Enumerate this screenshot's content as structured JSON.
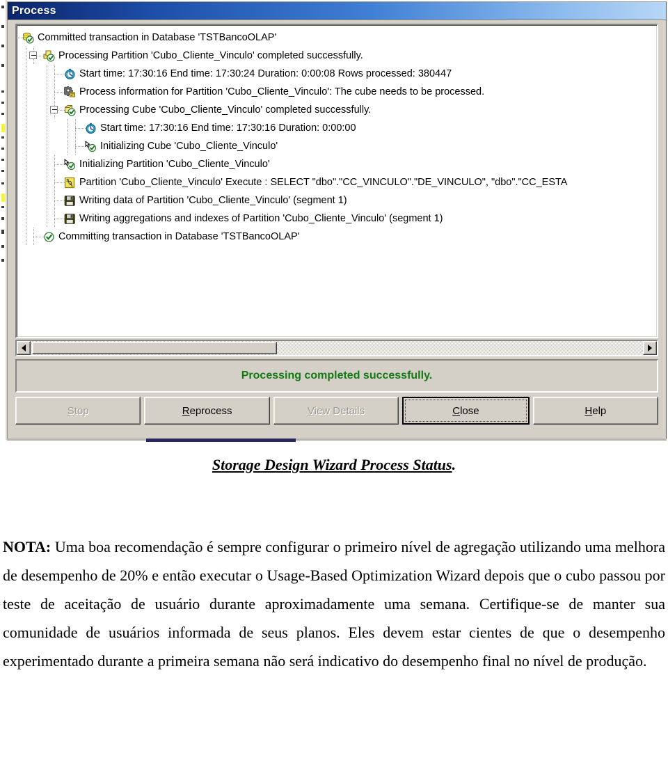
{
  "window": {
    "title": "Process",
    "status_message": "Processing completed successfully.",
    "status_color": "#137a13",
    "titlebar_gradient_start": "#0a246a",
    "titlebar_gradient_end": "#b7d6f5",
    "face_color": "#d4d0c8"
  },
  "tree": {
    "nodes": [
      {
        "icon": "database-commit-icon",
        "indent": 0,
        "expander": "collapse",
        "text": "Committed transaction in Database 'TSTBancoOLAP'"
      },
      {
        "icon": "partition-success-icon",
        "indent": 1,
        "expander": "collapse",
        "text": "Processing Partition 'Cubo_Cliente_Vinculo' completed successfully."
      },
      {
        "icon": "clock-icon",
        "indent": 2,
        "expander": "none",
        "text": "Start time: 17:30:16  End time: 17:30:24  Duration: 0:00:08  Rows processed: 380447"
      },
      {
        "icon": "gear-info-icon",
        "indent": 2,
        "expander": "none",
        "text": "Process information for Partition 'Cubo_Cliente_Vinculo': The cube needs to be processed."
      },
      {
        "icon": "cube-success-icon",
        "indent": 2,
        "expander": "collapse",
        "text": "Processing Cube 'Cubo_Cliente_Vinculo' completed successfully."
      },
      {
        "icon": "clock-icon",
        "indent": 3,
        "expander": "none",
        "text": "Start time: 17:30:16  End time: 17:30:16  Duration: 0:00:00"
      },
      {
        "icon": "initialize-icon",
        "indent": 3,
        "expander": "none",
        "text": "Initializing Cube 'Cubo_Cliente_Vinculo'"
      },
      {
        "icon": "initialize-icon",
        "indent": 2,
        "expander": "none",
        "text": "Initializing Partition 'Cubo_Cliente_Vinculo'"
      },
      {
        "icon": "sql-icon",
        "indent": 2,
        "expander": "none",
        "text": "Partition 'Cubo_Cliente_Vinculo' Execute : SELECT \"dbo\".\"CC_VINCULO\".\"DE_VINCULO\", \"dbo\".\"CC_ESTA"
      },
      {
        "icon": "diskette-icon",
        "indent": 2,
        "expander": "none",
        "text": "Writing data of Partition 'Cubo_Cliente_Vinculo' (segment  1)"
      },
      {
        "icon": "diskette-icon",
        "indent": 2,
        "expander": "none",
        "text": "Writing aggregations and indexes of Partition 'Cubo_Cliente_Vinculo' (segment  1)"
      },
      {
        "icon": "check-circle-icon",
        "indent": 1,
        "expander": "none",
        "text": "Committing transaction in Database 'TSTBancoOLAP'"
      }
    ]
  },
  "buttons": [
    {
      "label": "Stop",
      "accel": "S",
      "state": "disabled",
      "default": false
    },
    {
      "label": "Reprocess",
      "accel": "R",
      "state": "enabled",
      "default": false
    },
    {
      "label": "View Details",
      "accel": "V",
      "state": "disabled",
      "default": false
    },
    {
      "label": "Close",
      "accel": "C",
      "state": "enabled",
      "default": true
    },
    {
      "label": "Help",
      "accel": "H",
      "state": "enabled",
      "default": false
    }
  ],
  "document": {
    "caption": "Storage Design Wizard Process Status",
    "caption_trailing": ".",
    "note_label": "NOTA:",
    "note_body": " Uma boa recomendação é sempre configurar o primeiro nível de agregação utilizando uma melhora de desempenho de 20% e então executar o Usage-Based Optimization Wizard depois que o cubo passou por teste de aceitação de usuário durante aproximadamente uma semana. Certifique-se de manter sua comunidade de usuários informada de seus planos. Eles devem estar cientes de que o desempenho experimentado durante a primeira semana não será indicativo do desempenho final no nível de produção."
  }
}
